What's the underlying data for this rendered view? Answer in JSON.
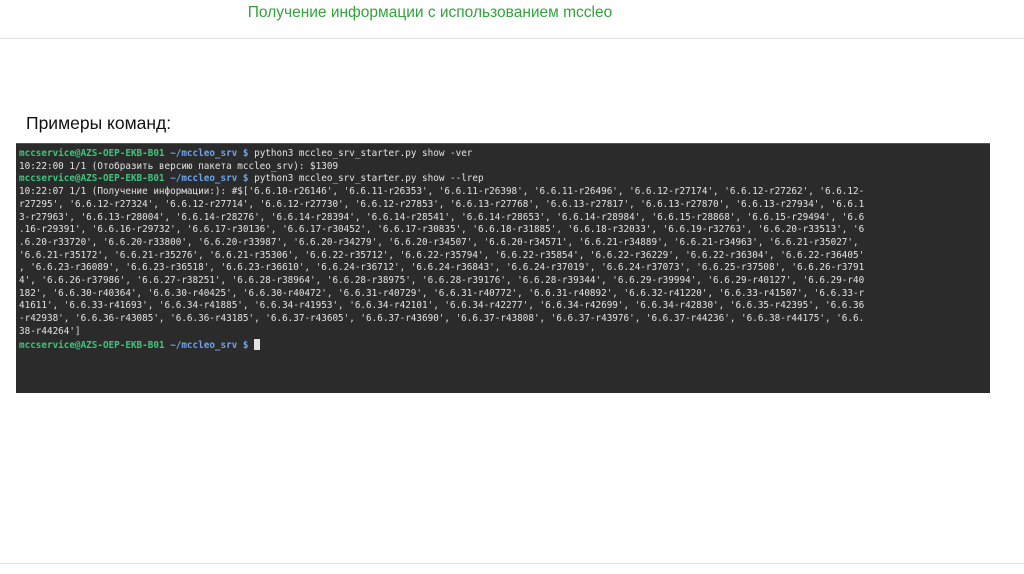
{
  "slide": {
    "title": "Получение информации с использованием mccleo",
    "section_heading": "Примеры команд:"
  },
  "terminal": {
    "prompt_user": "mccservice@AZS-OEP-EKB-B01",
    "prompt_path": "~/mccleo_srv $",
    "cmd1": " python3 mccleo_srv_starter.py show -ver",
    "out1": "10:22:00 1/1 (Отобразить версию пакета mccleo_srv): $1309",
    "cmd2": " python3 mccleo_srv_starter.py show --lrep",
    "out2": [
      "10:22:07 1/1 (Получение информации:): #$['6.6.10-r26146', '6.6.11-r26353', '6.6.11-r26398', '6.6.11-r26496', '6.6.12-r27174', '6.6.12-r27262', '6.6.12-",
      "r27295', '6.6.12-r27324', '6.6.12-r27714', '6.6.12-r27730', '6.6.12-r27853', '6.6.13-r27768', '6.6.13-r27817', '6.6.13-r27870', '6.6.13-r27934', '6.6.1",
      "3-r27963', '6.6.13-r28004', '6.6.14-r28276', '6.6.14-r28394', '6.6.14-r28541', '6.6.14-r28653', '6.6.14-r28984', '6.6.15-r28868', '6.6.15-r29494', '6.6",
      ".16-r29391', '6.6.16-r29732', '6.6.17-r30136', '6.6.17-r30452', '6.6.17-r30835', '6.6.18-r31885', '6.6.18-r32033', '6.6.19-r32763', '6.6.20-r33513', '6",
      ".6.20-r33720', '6.6.20-r33800', '6.6.20-r33987', '6.6.20-r34279', '6.6.20-r34507', '6.6.20-r34571', '6.6.21-r34889', '6.6.21-r34963', '6.6.21-r35027',",
      "'6.6.21-r35172', '6.6.21-r35276', '6.6.21-r35306', '6.6.22-r35712', '6.6.22-r35794', '6.6.22-r35854', '6.6.22-r36229', '6.6.22-r36304', '6.6.22-r36405'",
      ", '6.6.23-r36089', '6.6.23-r36518', '6.6.23-r36610', '6.6.24-r36712', '6.6.24-r36843', '6.6.24-r37019', '6.6.24-r37073', '6.6.25-r37508', '6.6.26-r3791",
      "4', '6.6.26-r37986', '6.6.27-r38251', '6.6.28-r38964', '6.6.28-r38975', '6.6.28-r39176', '6.6.28-r39344', '6.6.29-r39994', '6.6.29-r40127', '6.6.29-r40",
      "182', '6.6.30-r40364', '6.6.30-r40425', '6.6.30-r40472', '6.6.31-r40729', '6.6.31-r40772', '6.6.31-r40892', '6.6.32-r41220', '6.6.33-r41507', '6.6.33-r",
      "41611', '6.6.33-r41693', '6.6.34-r41885', '6.6.34-r41953', '6.6.34-r42101', '6.6.34-r42277', '6.6.34-r42699', '6.6.34-r42830', '6.6.35-r42395', '6.6.36",
      "-r42938', '6.6.36-r43085', '6.6.36-r43185', '6.6.37-r43605', '6.6.37-r43690', '6.6.37-r43808', '6.6.37-r43976', '6.6.37-r44236', '6.6.38-r44175', '6.6.",
      "38-r44264']"
    ]
  }
}
